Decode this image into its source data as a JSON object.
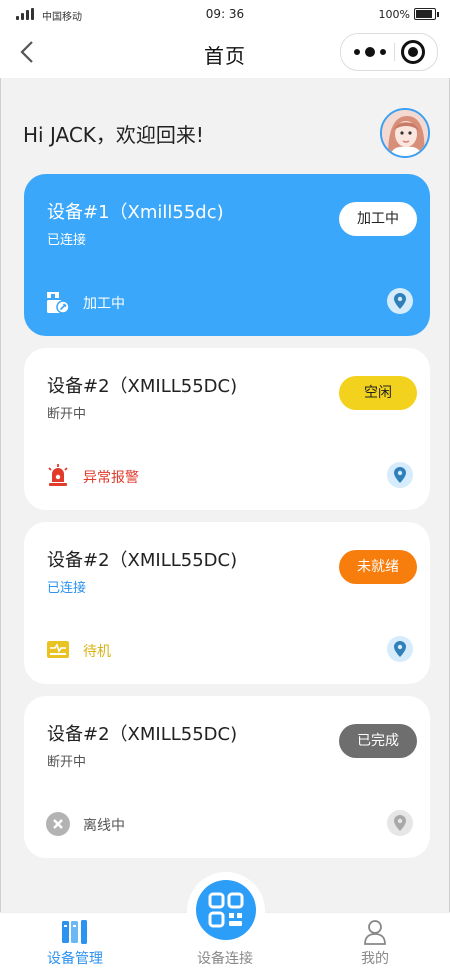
{
  "status_bar": {
    "carrier": "中国移动",
    "time": "09: 36",
    "battery": "100%"
  },
  "nav": {
    "title": "首页"
  },
  "greeting": "Hi JACK，欢迎回来!",
  "devices": [
    {
      "name": "设备#1（Xmill55dc)",
      "connection": "已连接",
      "badge": "加工中",
      "status": "加工中",
      "status_icon": "machining-icon"
    },
    {
      "name": "设备#2（XMILL55DC)",
      "connection": "断开中",
      "badge": "空闲",
      "status": "异常报警",
      "status_icon": "alarm-icon"
    },
    {
      "name": "设备#2（XMILL55DC)",
      "connection": "已连接",
      "badge": "未就绪",
      "status": "待机",
      "status_icon": "standby-icon"
    },
    {
      "name": "设备#2（XMILL55DC)",
      "connection": "断开中",
      "badge": "已完成",
      "status": "离线中",
      "status_icon": "offline-icon"
    }
  ],
  "tabs": [
    {
      "label": "设备管理",
      "icon": "device-management-icon"
    },
    {
      "label": "设备连接",
      "icon": "qr-scan-icon"
    },
    {
      "label": "我的",
      "icon": "user-icon"
    }
  ],
  "colors": {
    "accent": "#3aa7fb",
    "badge_idle": "#f3d21d",
    "badge_not_ready": "#f77d0c",
    "badge_done": "#6e6e6e",
    "alarm": "#e03b2b",
    "standby": "#e8c323",
    "connected_text": "#2d93f0"
  }
}
